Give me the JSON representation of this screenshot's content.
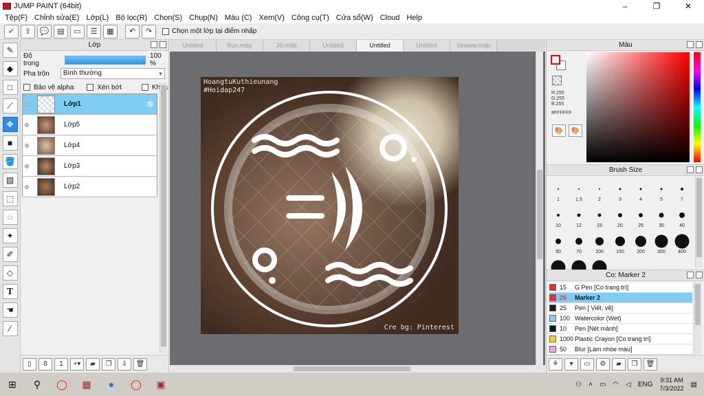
{
  "window": {
    "title": "JUMP PAINT (64bit)",
    "min_label": "–",
    "max_label": "❐",
    "close_label": "✕"
  },
  "menu": [
    "Tệp(F)",
    "Chỉnh sửa(E)",
    "Lớp(L)",
    "Bộ lọc(R)",
    "Chọn(S)",
    "Chụp(N)",
    "Màu (C)",
    "Xem(V)",
    "Công cụ(T)",
    "Cửa sổ(W)",
    "Cloud",
    "Help"
  ],
  "toolbar": {
    "option_label": "Chọn một lớp tại điểm nhấp"
  },
  "layer_panel": {
    "title": "Lớp",
    "opacity_label": "Độ trong",
    "opacity_value": "100 %",
    "blend_label": "Pha trộn",
    "blend_value": "Bình thường",
    "protect_alpha": "Bảo vệ alpha",
    "clipping": "Xén bớt",
    "lock": "Khóa",
    "layers": [
      {
        "name": "Lớp1",
        "selected": true
      },
      {
        "name": "Lớp5",
        "selected": false
      },
      {
        "name": "Lớp4",
        "selected": false
      },
      {
        "name": "Lớp3",
        "selected": false
      },
      {
        "name": "Lớp2",
        "selected": false
      }
    ]
  },
  "tabs": [
    "Untitled",
    "Bun.mdp",
    "30.mdp",
    "Untitled",
    "Untitled",
    "Untitled",
    "Yewww.mdp"
  ],
  "active_tab_index": 4,
  "canvas": {
    "watermark_line1": "HoangtuKuthieunang",
    "watermark_line2": "#Hoidap247",
    "credit": "Cre bg: Pinterest"
  },
  "color_panel": {
    "title": "Màu",
    "r": "R:255",
    "g": "G:255",
    "b": "B:255",
    "hex": "#FFFFFF",
    "fg_color": "#ff0000",
    "bg_color": "#ffffff"
  },
  "brush_panel": {
    "title": "Brush Size",
    "sizes": [
      "1",
      "1.5",
      "2",
      "3",
      "4",
      "5",
      "7",
      "10",
      "12",
      "15",
      "20",
      "25",
      "30",
      "40",
      "50",
      "70",
      "100",
      "150",
      "200",
      "300",
      "400",
      "",
      "",
      ""
    ]
  },
  "preset_panel": {
    "title": "Co: Marker 2",
    "items": [
      {
        "size": "15",
        "name": "G Pen [Co trang trí]",
        "color": "#e83030",
        "selected": false
      },
      {
        "size": "25",
        "name": "Marker 2",
        "color": "#e83030",
        "selected": true
      },
      {
        "size": "25",
        "name": "Pen [ Viết, vẽ]",
        "color": "#1a1a1a",
        "selected": false
      },
      {
        "size": "100",
        "name": "Watercolor (Wet)",
        "color": "#7fd3f2",
        "selected": false
      },
      {
        "size": "10",
        "name": "Pen [Nét mảnh]",
        "color": "#1a1a1a",
        "selected": false
      },
      {
        "size": "1000",
        "name": "Plastic Crayon [Co trang trí]",
        "color": "#f2d21a",
        "selected": false
      },
      {
        "size": "50",
        "name": "Blur [Làm nhòe màu]",
        "color": "#f0a6d8",
        "selected": false
      }
    ]
  },
  "taskbar": {
    "lang": "ENG",
    "time": "9:31 AM",
    "date": "7/3/2022"
  }
}
